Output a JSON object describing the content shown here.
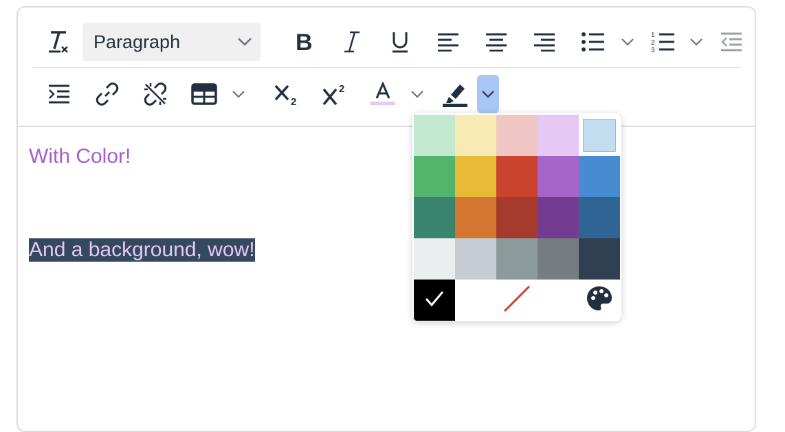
{
  "toolbar": {
    "block_format": "Paragraph",
    "highlight_color": "#222f3e",
    "text_color_underline": "#e6c8f5",
    "active_bg": "#a9c6f5"
  },
  "content": {
    "line1": "With Color!",
    "line1_color": "#a35fc8",
    "line2": "And a background, wow!",
    "line2_color": "#e6c8f5",
    "line2_bg": "#34495e"
  },
  "swatches": {
    "colors": [
      "#bfedd2",
      "#fbeeb8",
      "#f8cac6",
      "#eccafa",
      "#c2e0f4",
      "#2dc26b",
      "#f1c40f",
      "#e03e2d",
      "#b96ad9",
      "#3598db",
      "#169179",
      "#e67e23",
      "#ba372a",
      "#843fa1",
      "#236fa1",
      "#ecf0f1",
      "#ced4d9",
      "#95a5a6",
      "#7e8c8d",
      "#34495e"
    ],
    "display_colors": [
      "#c2e8cf",
      "#f8eab3",
      "#efc6c3",
      "#e6c8f5",
      "#c2dcf0",
      "#52b56b",
      "#e8bb37",
      "#c9432f",
      "#a663c8",
      "#478cd2",
      "#3a846f",
      "#d47630",
      "#a53a2d",
      "#743c91",
      "#2f6494",
      "#eaeeef",
      "#c8cdd3",
      "#8d9a9b",
      "#747e80",
      "#303f52"
    ],
    "selected_index": 4,
    "actions": {
      "black_selected": "#000000",
      "remove_color_stroke": "#c9432f",
      "custom_icon": "palette-icon"
    }
  }
}
